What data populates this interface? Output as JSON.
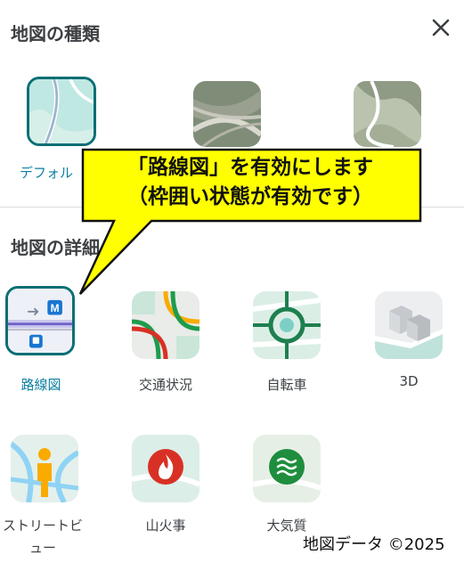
{
  "header": {
    "title": "地図の種類"
  },
  "map_types": [
    {
      "label": "デフォル"
    }
  ],
  "details_section": {
    "title": "地図の詳細"
  },
  "details": [
    {
      "label": "路線図",
      "badge": "M"
    },
    {
      "label": "交通状況"
    },
    {
      "label": "自転車"
    },
    {
      "label": "3D"
    },
    {
      "label": "ストリートビ"
    },
    {
      "label": "ュー"
    },
    {
      "label": "山火事"
    },
    {
      "label": "大気質"
    }
  ],
  "callout": {
    "line1": "「路線図」を有効にします",
    "line2": "（枠囲い状態が有効です）"
  },
  "footer": {
    "copyright": "地図データ ©2025"
  },
  "colors": {
    "selected_border": "#0b6f74",
    "selected_label": "#0b7fa0",
    "callout_fill": "#ffff00"
  }
}
